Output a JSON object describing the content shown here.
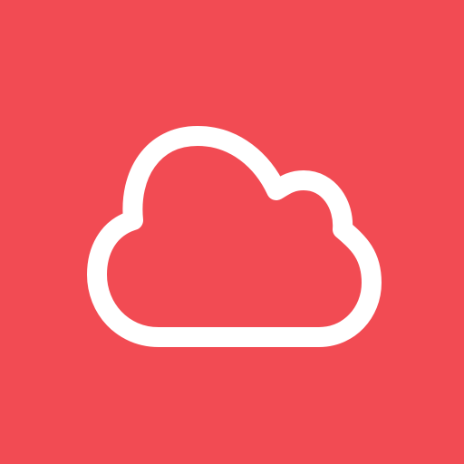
{
  "icon": {
    "name": "cloud-icon",
    "background_color": "#F24B53",
    "foreground_color": "#FFFFFF"
  }
}
